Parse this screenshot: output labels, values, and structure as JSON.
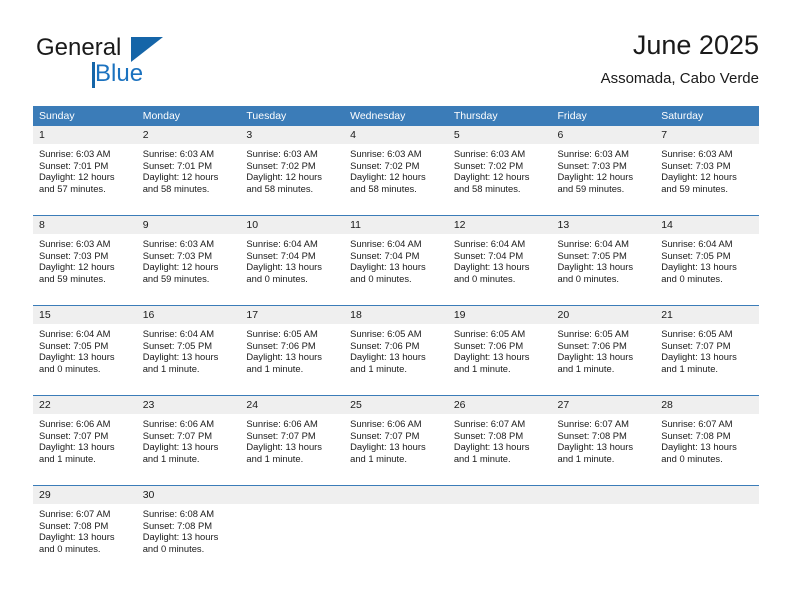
{
  "brand": {
    "name_top": "General",
    "name_bottom": "Blue",
    "triangle_color": "#1565a8",
    "blue_color": "#1b72bf"
  },
  "header": {
    "title": "June 2025",
    "subtitle": "Assomada, Cabo Verde"
  },
  "theme": {
    "header_bg": "#3b7cb8",
    "daynum_bg": "#efefef",
    "row_divider": "#3b7cb8",
    "text": "#1a1a1a"
  },
  "weekdays": [
    "Sunday",
    "Monday",
    "Tuesday",
    "Wednesday",
    "Thursday",
    "Friday",
    "Saturday"
  ],
  "weeks": [
    [
      {
        "day": "1",
        "sunrise": "Sunrise: 6:03 AM",
        "sunset": "Sunset: 7:01 PM",
        "daylight_1": "Daylight: 12 hours",
        "daylight_2": "and 57 minutes."
      },
      {
        "day": "2",
        "sunrise": "Sunrise: 6:03 AM",
        "sunset": "Sunset: 7:01 PM",
        "daylight_1": "Daylight: 12 hours",
        "daylight_2": "and 58 minutes."
      },
      {
        "day": "3",
        "sunrise": "Sunrise: 6:03 AM",
        "sunset": "Sunset: 7:02 PM",
        "daylight_1": "Daylight: 12 hours",
        "daylight_2": "and 58 minutes."
      },
      {
        "day": "4",
        "sunrise": "Sunrise: 6:03 AM",
        "sunset": "Sunset: 7:02 PM",
        "daylight_1": "Daylight: 12 hours",
        "daylight_2": "and 58 minutes."
      },
      {
        "day": "5",
        "sunrise": "Sunrise: 6:03 AM",
        "sunset": "Sunset: 7:02 PM",
        "daylight_1": "Daylight: 12 hours",
        "daylight_2": "and 58 minutes."
      },
      {
        "day": "6",
        "sunrise": "Sunrise: 6:03 AM",
        "sunset": "Sunset: 7:03 PM",
        "daylight_1": "Daylight: 12 hours",
        "daylight_2": "and 59 minutes."
      },
      {
        "day": "7",
        "sunrise": "Sunrise: 6:03 AM",
        "sunset": "Sunset: 7:03 PM",
        "daylight_1": "Daylight: 12 hours",
        "daylight_2": "and 59 minutes."
      }
    ],
    [
      {
        "day": "8",
        "sunrise": "Sunrise: 6:03 AM",
        "sunset": "Sunset: 7:03 PM",
        "daylight_1": "Daylight: 12 hours",
        "daylight_2": "and 59 minutes."
      },
      {
        "day": "9",
        "sunrise": "Sunrise: 6:03 AM",
        "sunset": "Sunset: 7:03 PM",
        "daylight_1": "Daylight: 12 hours",
        "daylight_2": "and 59 minutes."
      },
      {
        "day": "10",
        "sunrise": "Sunrise: 6:04 AM",
        "sunset": "Sunset: 7:04 PM",
        "daylight_1": "Daylight: 13 hours",
        "daylight_2": "and 0 minutes."
      },
      {
        "day": "11",
        "sunrise": "Sunrise: 6:04 AM",
        "sunset": "Sunset: 7:04 PM",
        "daylight_1": "Daylight: 13 hours",
        "daylight_2": "and 0 minutes."
      },
      {
        "day": "12",
        "sunrise": "Sunrise: 6:04 AM",
        "sunset": "Sunset: 7:04 PM",
        "daylight_1": "Daylight: 13 hours",
        "daylight_2": "and 0 minutes."
      },
      {
        "day": "13",
        "sunrise": "Sunrise: 6:04 AM",
        "sunset": "Sunset: 7:05 PM",
        "daylight_1": "Daylight: 13 hours",
        "daylight_2": "and 0 minutes."
      },
      {
        "day": "14",
        "sunrise": "Sunrise: 6:04 AM",
        "sunset": "Sunset: 7:05 PM",
        "daylight_1": "Daylight: 13 hours",
        "daylight_2": "and 0 minutes."
      }
    ],
    [
      {
        "day": "15",
        "sunrise": "Sunrise: 6:04 AM",
        "sunset": "Sunset: 7:05 PM",
        "daylight_1": "Daylight: 13 hours",
        "daylight_2": "and 0 minutes."
      },
      {
        "day": "16",
        "sunrise": "Sunrise: 6:04 AM",
        "sunset": "Sunset: 7:05 PM",
        "daylight_1": "Daylight: 13 hours",
        "daylight_2": "and 1 minute."
      },
      {
        "day": "17",
        "sunrise": "Sunrise: 6:05 AM",
        "sunset": "Sunset: 7:06 PM",
        "daylight_1": "Daylight: 13 hours",
        "daylight_2": "and 1 minute."
      },
      {
        "day": "18",
        "sunrise": "Sunrise: 6:05 AM",
        "sunset": "Sunset: 7:06 PM",
        "daylight_1": "Daylight: 13 hours",
        "daylight_2": "and 1 minute."
      },
      {
        "day": "19",
        "sunrise": "Sunrise: 6:05 AM",
        "sunset": "Sunset: 7:06 PM",
        "daylight_1": "Daylight: 13 hours",
        "daylight_2": "and 1 minute."
      },
      {
        "day": "20",
        "sunrise": "Sunrise: 6:05 AM",
        "sunset": "Sunset: 7:06 PM",
        "daylight_1": "Daylight: 13 hours",
        "daylight_2": "and 1 minute."
      },
      {
        "day": "21",
        "sunrise": "Sunrise: 6:05 AM",
        "sunset": "Sunset: 7:07 PM",
        "daylight_1": "Daylight: 13 hours",
        "daylight_2": "and 1 minute."
      }
    ],
    [
      {
        "day": "22",
        "sunrise": "Sunrise: 6:06 AM",
        "sunset": "Sunset: 7:07 PM",
        "daylight_1": "Daylight: 13 hours",
        "daylight_2": "and 1 minute."
      },
      {
        "day": "23",
        "sunrise": "Sunrise: 6:06 AM",
        "sunset": "Sunset: 7:07 PM",
        "daylight_1": "Daylight: 13 hours",
        "daylight_2": "and 1 minute."
      },
      {
        "day": "24",
        "sunrise": "Sunrise: 6:06 AM",
        "sunset": "Sunset: 7:07 PM",
        "daylight_1": "Daylight: 13 hours",
        "daylight_2": "and 1 minute."
      },
      {
        "day": "25",
        "sunrise": "Sunrise: 6:06 AM",
        "sunset": "Sunset: 7:07 PM",
        "daylight_1": "Daylight: 13 hours",
        "daylight_2": "and 1 minute."
      },
      {
        "day": "26",
        "sunrise": "Sunrise: 6:07 AM",
        "sunset": "Sunset: 7:08 PM",
        "daylight_1": "Daylight: 13 hours",
        "daylight_2": "and 1 minute."
      },
      {
        "day": "27",
        "sunrise": "Sunrise: 6:07 AM",
        "sunset": "Sunset: 7:08 PM",
        "daylight_1": "Daylight: 13 hours",
        "daylight_2": "and 1 minute."
      },
      {
        "day": "28",
        "sunrise": "Sunrise: 6:07 AM",
        "sunset": "Sunset: 7:08 PM",
        "daylight_1": "Daylight: 13 hours",
        "daylight_2": "and 0 minutes."
      }
    ],
    [
      {
        "day": "29",
        "sunrise": "Sunrise: 6:07 AM",
        "sunset": "Sunset: 7:08 PM",
        "daylight_1": "Daylight: 13 hours",
        "daylight_2": "and 0 minutes."
      },
      {
        "day": "30",
        "sunrise": "Sunrise: 6:08 AM",
        "sunset": "Sunset: 7:08 PM",
        "daylight_1": "Daylight: 13 hours",
        "daylight_2": "and 0 minutes."
      },
      {
        "day": "",
        "sunrise": "",
        "sunset": "",
        "daylight_1": "",
        "daylight_2": ""
      },
      {
        "day": "",
        "sunrise": "",
        "sunset": "",
        "daylight_1": "",
        "daylight_2": ""
      },
      {
        "day": "",
        "sunrise": "",
        "sunset": "",
        "daylight_1": "",
        "daylight_2": ""
      },
      {
        "day": "",
        "sunrise": "",
        "sunset": "",
        "daylight_1": "",
        "daylight_2": ""
      },
      {
        "day": "",
        "sunrise": "",
        "sunset": "",
        "daylight_1": "",
        "daylight_2": ""
      }
    ]
  ]
}
